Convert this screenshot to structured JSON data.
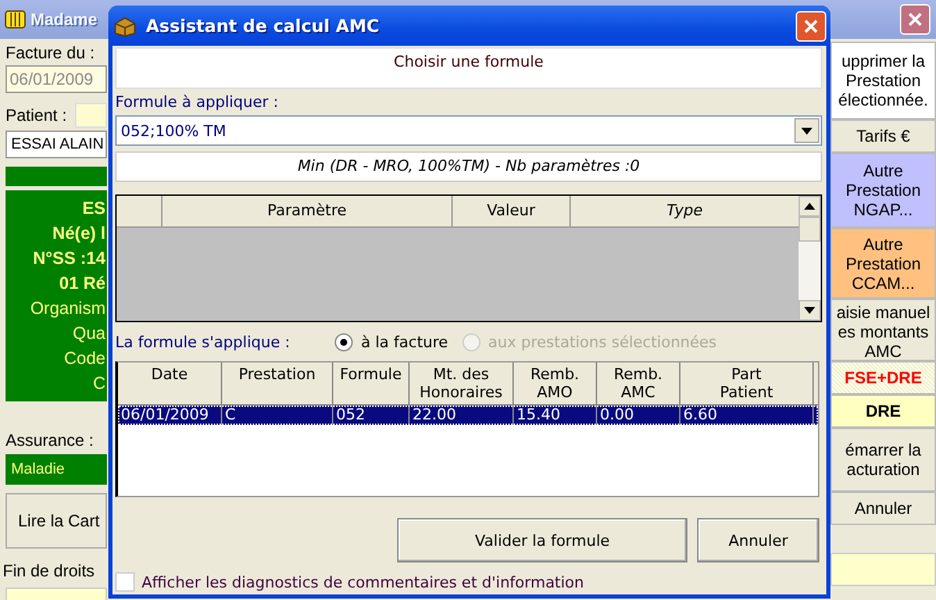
{
  "main_window": {
    "title": "Madame",
    "left_panel": {
      "invoice_label": "Facture du :",
      "invoice_date": "06/01/2009",
      "patient_label": "Patient :",
      "patient_name": "ESSAI ALAIN",
      "card_lines": [
        {
          "text": "ES",
          "bold": true
        },
        {
          "text": "Né(e) l",
          "bold": true
        },
        {
          "text": "N°SS :14",
          "bold": true
        },
        {
          "text": "01 Ré",
          "bold": true
        },
        {
          "text": "Organism",
          "bold": false
        },
        {
          "text": "Qua",
          "bold": false
        },
        {
          "text": "Code",
          "bold": false
        },
        {
          "text": "C",
          "bold": false
        }
      ],
      "insurance_label": "Assurance :",
      "insurance_value": "Maladie",
      "read_card_button": "Lire la Cart",
      "rights_end_label": "Fin de droits"
    },
    "right_buttons": [
      {
        "lines": [
          "upprimer la",
          "Prestation",
          "électionnée."
        ],
        "kind": "button",
        "color": "#ffffff"
      },
      {
        "lines": [
          "Tarifs €"
        ],
        "kind": "button",
        "color": "#ece9d8"
      },
      {
        "lines": [
          "Autre",
          "Prestation",
          "NGAP..."
        ],
        "kind": "button",
        "color": "#c0c0ff"
      },
      {
        "lines": [
          "Autre",
          "Prestation",
          "CCAM..."
        ],
        "kind": "button",
        "color": "#ffc080"
      },
      {
        "lines": [
          "aisie manuel",
          "es montants",
          "AMC"
        ],
        "kind": "button",
        "color": "#ece9d8"
      },
      {
        "lines": [
          "FSE+DRE"
        ],
        "kind": "alert",
        "color": "#ffffe0"
      },
      {
        "lines": [
          "DRE"
        ],
        "kind": "flag",
        "color": "#ffffc0"
      },
      {
        "lines": [
          "émarrer la",
          "acturation"
        ],
        "kind": "button",
        "color": "#ece9d8"
      },
      {
        "lines": [
          "Annuler"
        ],
        "kind": "button",
        "color": "#ece9d8"
      }
    ]
  },
  "dialog": {
    "title": "Assistant de calcul AMC",
    "header": "Choisir une formule",
    "formula_label": "Formule à appliquer :",
    "formula_value": "052;100% TM",
    "formula_description": "Min (DR - MRO, 100%TM) - Nb paramètres :0",
    "param_columns": [
      {
        "italic": false
      },
      {
        "label": "Paramètre",
        "italic": false
      },
      {
        "label": "Valeur",
        "italic": false
      },
      {
        "label": "Type",
        "italic": true
      }
    ],
    "apply_label": "La formule s'applique :",
    "apply_options": [
      {
        "label": "à la facture",
        "selected": true,
        "disabled": false
      },
      {
        "label": "aux prestations sélectionnées",
        "selected": false,
        "disabled": true
      }
    ],
    "table": {
      "columns": [
        {
          "lines": [
            "Date"
          ]
        },
        {
          "lines": [
            "Prestation"
          ]
        },
        {
          "lines": [
            "Formule"
          ]
        },
        {
          "lines": [
            "Mt. des",
            "Honoraires"
          ]
        },
        {
          "lines": [
            "Remb.",
            "AMO"
          ]
        },
        {
          "lines": [
            "Remb.",
            "AMC"
          ]
        },
        {
          "lines": [
            "Part",
            "Patient"
          ]
        }
      ],
      "rows": [
        {
          "cells": [
            "06/01/2009",
            "C",
            "052",
            "22.00",
            "15.40",
            "0.00",
            "6.60"
          ],
          "selected": true
        }
      ]
    },
    "buttons": [
      "Valider la formule",
      "Annuler"
    ],
    "diagnostics_checkbox": {
      "label": "Afficher les diagnostics de commentaires et d'information",
      "checked": false
    }
  }
}
